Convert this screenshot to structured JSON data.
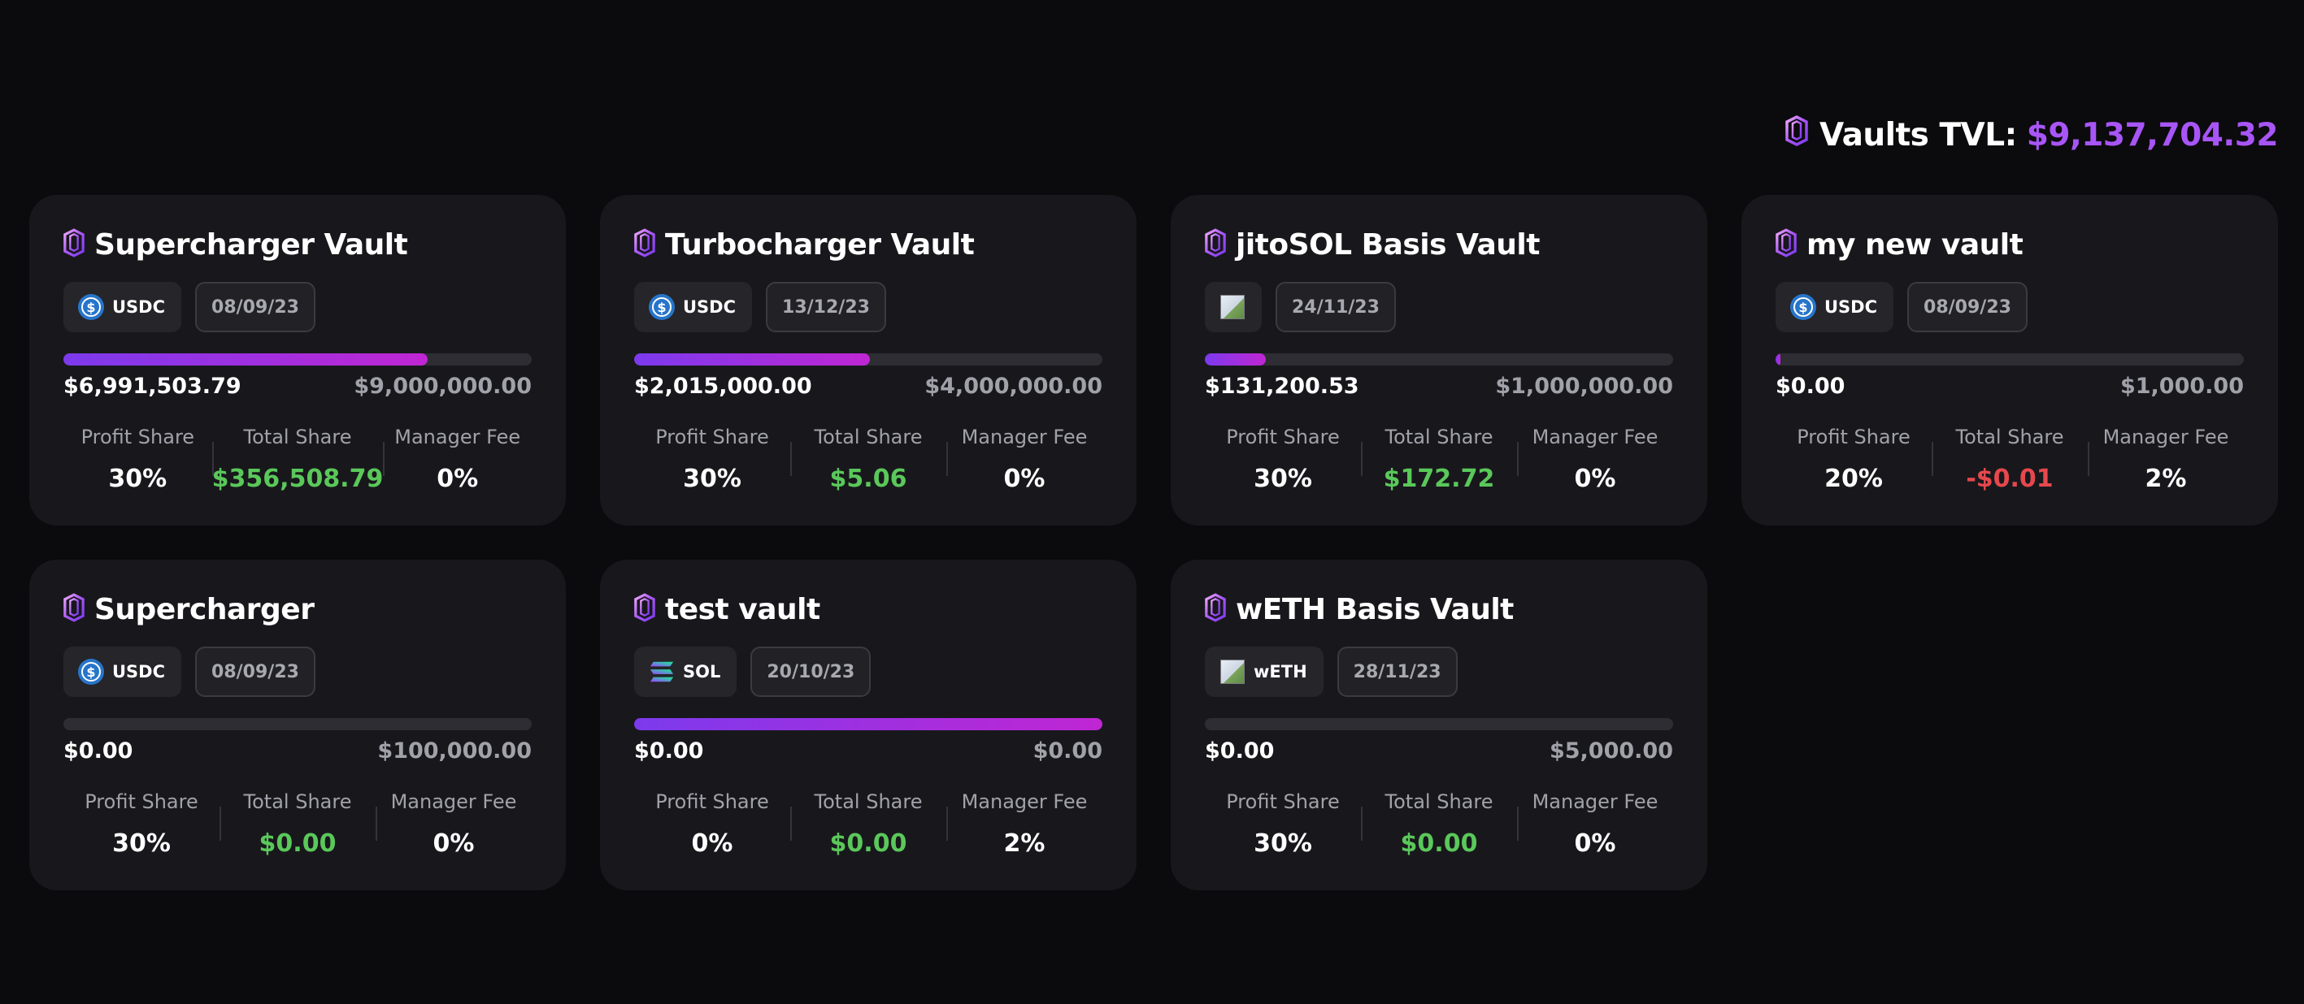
{
  "tvl": {
    "label": "Vaults TVL:",
    "value": "$9,137,704.32"
  },
  "colors": {
    "accent_purple": "#a855f7",
    "bar_gradient_start": "#7c3aed",
    "bar_gradient_end": "#c026d3",
    "positive": "#5ac85a",
    "negative": "#e5484d",
    "card_bg": "#18181c",
    "page_bg": "#0b0b0d"
  },
  "labels": {
    "profit_share": "Profit Share",
    "total_share": "Total Share",
    "manager_fee": "Manager Fee"
  },
  "vaults": [
    {
      "name": "Supercharger Vault",
      "token": "USDC",
      "token_icon": "usdc-icon",
      "date": "08/09/23",
      "progress": 0.777,
      "current": "$6,991,503.79",
      "cap": "$9,000,000.00",
      "profit_share": "30%",
      "total_share": "$356,508.79",
      "total_share_sign": "pos",
      "manager_fee": "0%"
    },
    {
      "name": "Turbocharger Vault",
      "token": "USDC",
      "token_icon": "usdc-icon",
      "date": "13/12/23",
      "progress": 0.504,
      "current": "$2,015,000.00",
      "cap": "$4,000,000.00",
      "profit_share": "30%",
      "total_share": "$5.06",
      "total_share_sign": "pos",
      "manager_fee": "0%"
    },
    {
      "name": "jitoSOL Basis Vault",
      "token": "",
      "token_icon": "broken-image-icon",
      "date": "24/11/23",
      "progress": 0.131,
      "current": "$131,200.53",
      "cap": "$1,000,000.00",
      "profit_share": "30%",
      "total_share": "$172.72",
      "total_share_sign": "pos",
      "manager_fee": "0%"
    },
    {
      "name": "my new vault",
      "token": "USDC",
      "token_icon": "usdc-icon",
      "date": "08/09/23",
      "progress": 0.0,
      "current": "$0.00",
      "cap": "$1,000.00",
      "profit_share": "20%",
      "total_share": "-$0.01",
      "total_share_sign": "neg",
      "manager_fee": "2%"
    },
    {
      "name": "Supercharger",
      "token": "USDC",
      "token_icon": "usdc-icon",
      "date": "08/09/23",
      "progress": 0.0,
      "current": "$0.00",
      "cap": "$100,000.00",
      "profit_share": "30%",
      "total_share": "$0.00",
      "total_share_sign": "pos",
      "manager_fee": "0%"
    },
    {
      "name": "test vault",
      "token": "SOL",
      "token_icon": "sol-icon",
      "date": "20/10/23",
      "progress": 1.0,
      "current": "$0.00",
      "cap": "$0.00",
      "profit_share": "0%",
      "total_share": "$0.00",
      "total_share_sign": "pos",
      "manager_fee": "2%"
    },
    {
      "name": "wETH Basis Vault",
      "token": "wETH",
      "token_icon": "broken-image-icon",
      "date": "28/11/23",
      "progress": 0.0,
      "current": "$0.00",
      "cap": "$5,000.00",
      "profit_share": "30%",
      "total_share": "$0.00",
      "total_share_sign": "pos",
      "manager_fee": "0%"
    }
  ]
}
